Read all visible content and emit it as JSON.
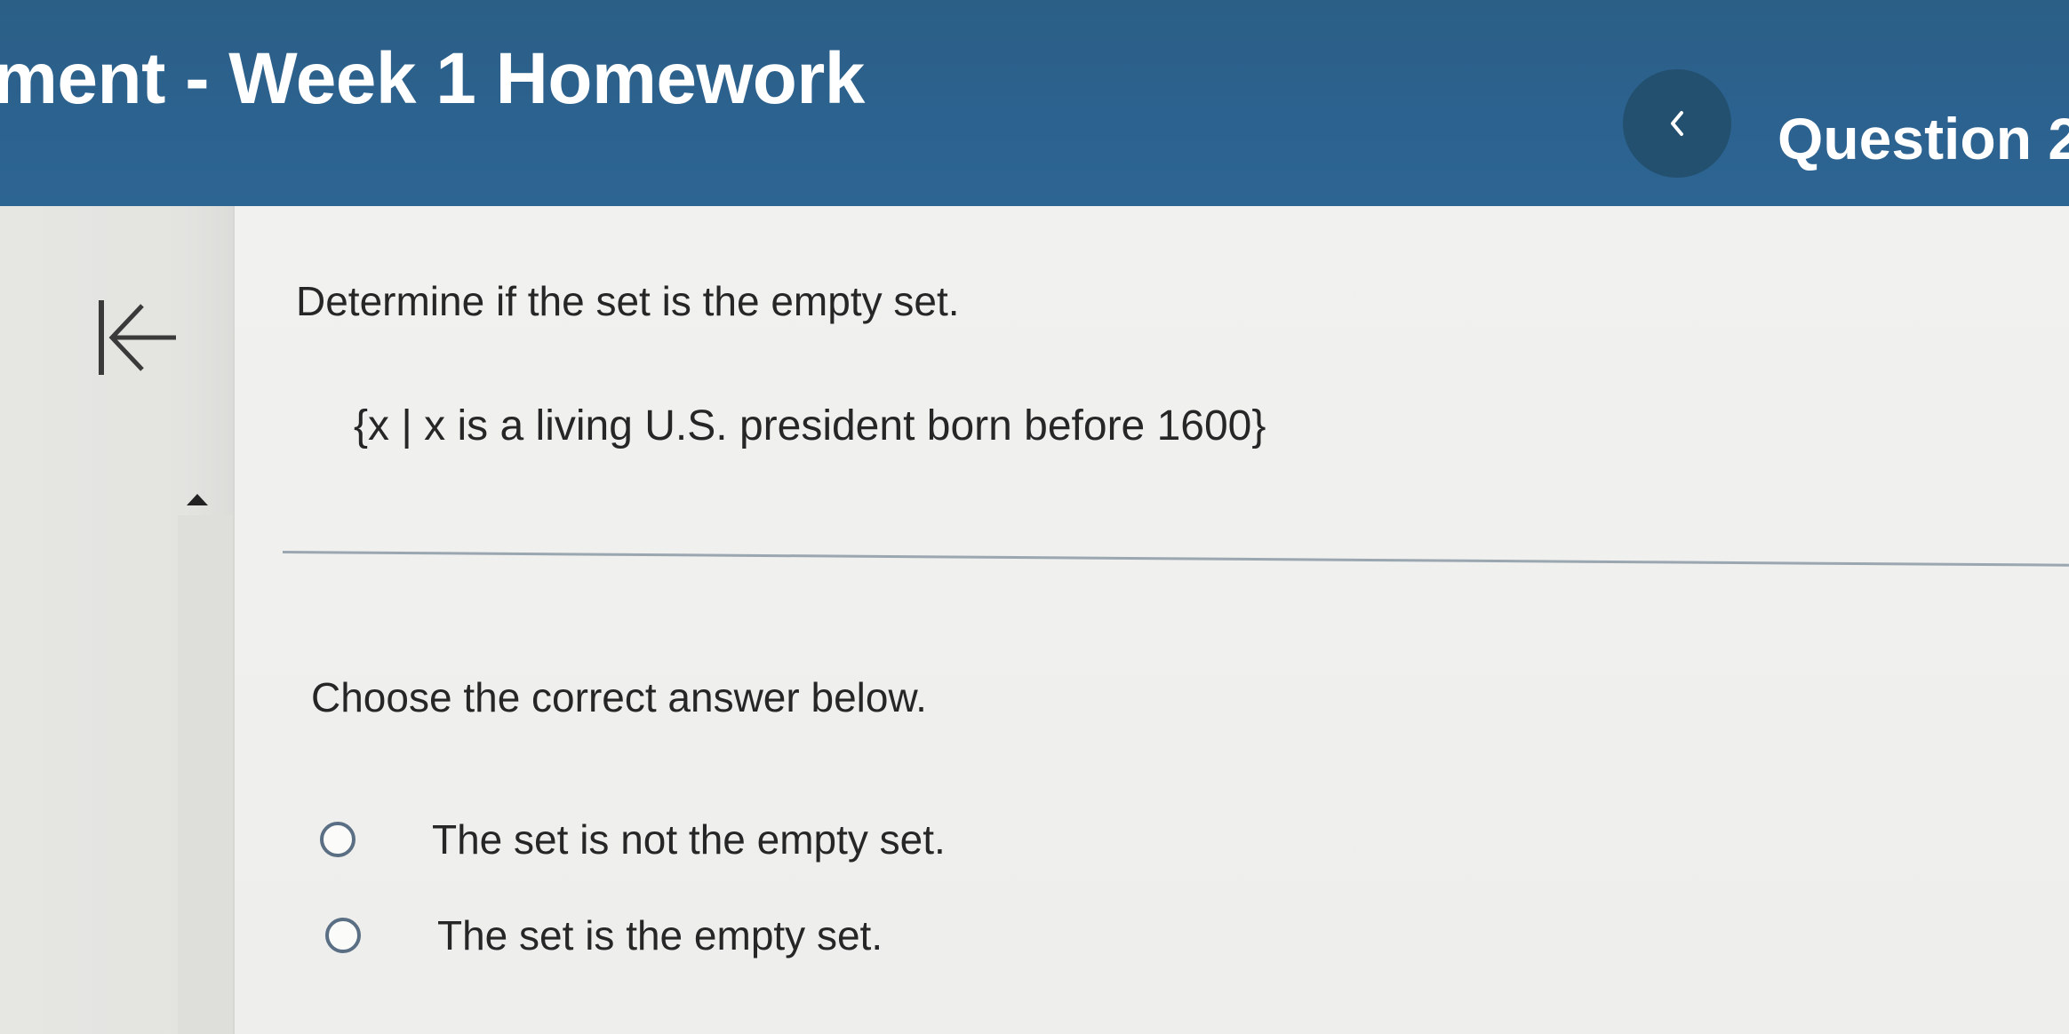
{
  "header": {
    "title": "ment - Week 1 Homework",
    "question_label": "Question 2",
    "colors": {
      "bar": "#2c6290",
      "prev_button": "#23506f"
    },
    "prev_icon": "chevron-left-icon"
  },
  "nav": {
    "first_icon": "first-page-arrow-icon",
    "collapse_icon": "triangle-up-icon"
  },
  "question": {
    "prompt": "Determine if the set is the empty set.",
    "set_expression": "{x | x is a living U.S. president born before 1600}",
    "instruction": "Choose the correct answer below.",
    "options": [
      {
        "label": "The set is not the empty set.",
        "selected": false
      },
      {
        "label": "The set is the empty set.",
        "selected": false
      }
    ]
  }
}
